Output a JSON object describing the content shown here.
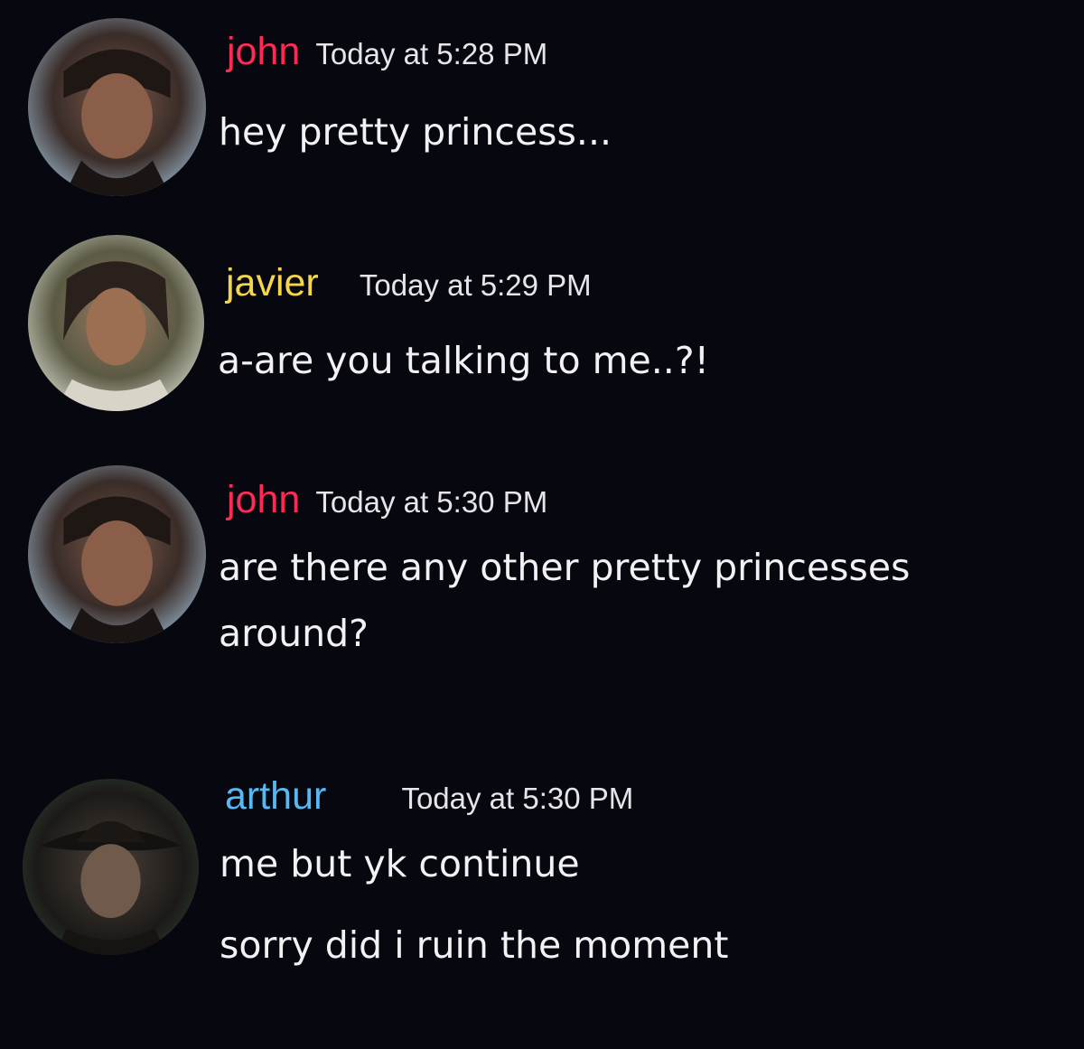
{
  "colors": {
    "background": "#06070f",
    "john": "#ff2a55",
    "javier": "#f5d64a",
    "arthur": "#57b8f2",
    "text": "#f2f2f5"
  },
  "messages": [
    {
      "author": "john",
      "time": "Today at 5:28 PM",
      "avatar_icon": "user-avatar-icon",
      "lines": [
        "hey pretty princess..."
      ]
    },
    {
      "author": "javier",
      "time": "Today at 5:29 PM",
      "avatar_icon": "user-avatar-icon",
      "lines": [
        "a-are you talking to me..?!"
      ]
    },
    {
      "author": "john",
      "time": "Today at 5:30 PM",
      "avatar_icon": "user-avatar-icon",
      "lines": [
        "are there any other pretty princesses",
        "around?"
      ]
    },
    {
      "author": "arthur",
      "time": "Today at 5:30 PM",
      "avatar_icon": "user-avatar-icon",
      "lines": [
        "me but yk continue",
        "sorry did i ruin the moment"
      ]
    }
  ]
}
